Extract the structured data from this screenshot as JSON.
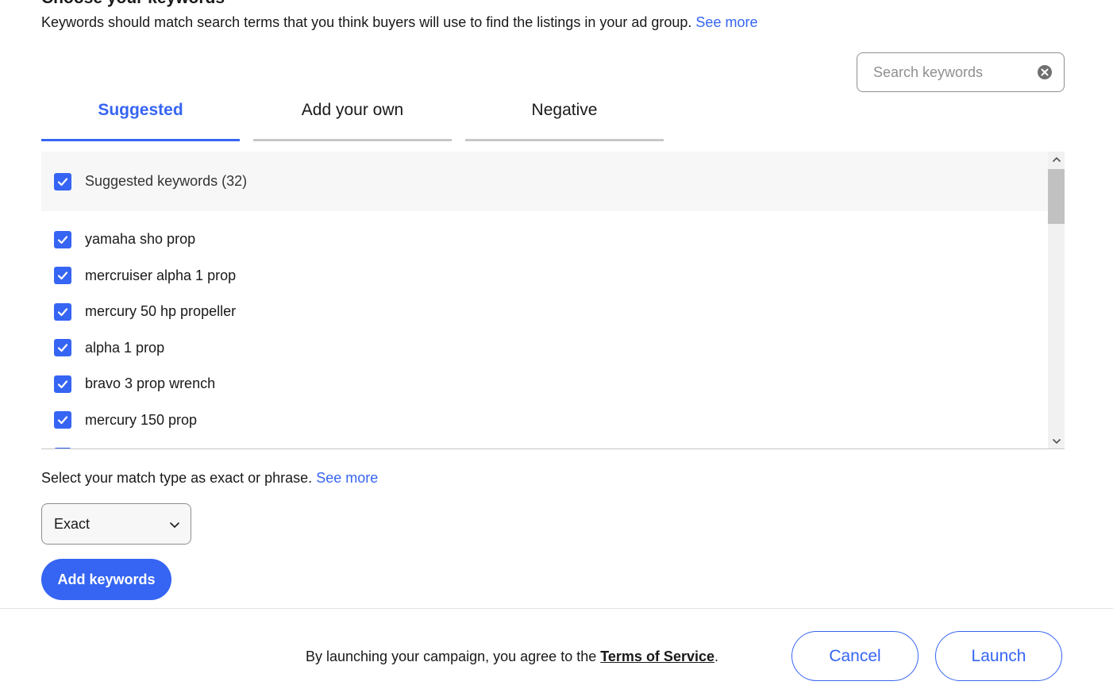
{
  "section": {
    "title": "Choose your keywords",
    "intro": "Keywords should match search terms that you think buyers will use to find the listings in your ad group.",
    "intro_link": "See more"
  },
  "search": {
    "placeholder": "Search keywords",
    "clear_icon": "clear-circle-icon"
  },
  "tabs": [
    {
      "label": "Suggested",
      "active": true
    },
    {
      "label": "Add your own",
      "active": false
    },
    {
      "label": "Negative",
      "active": false
    }
  ],
  "keywords": {
    "header_label": "Suggested keywords (32)",
    "header_checked": true,
    "items": [
      {
        "label": "yamaha sho prop",
        "checked": true
      },
      {
        "label": "mercruiser alpha 1 prop",
        "checked": true
      },
      {
        "label": "mercury 50 hp propeller",
        "checked": true
      },
      {
        "label": "alpha 1 prop",
        "checked": true
      },
      {
        "label": "bravo 3 prop wrench",
        "checked": true
      },
      {
        "label": "mercury 150 prop",
        "checked": true
      },
      {
        "label": "",
        "checked": true
      }
    ]
  },
  "match_type": {
    "text": "Select your match type as exact or phrase.",
    "link": "See more",
    "selected": "Exact"
  },
  "add_button": "Add keywords",
  "footer": {
    "terms_prefix": "By launching your campaign, you agree to the",
    "terms_link": "Terms of Service",
    "terms_suffix": ".",
    "cancel_label": "Cancel",
    "launch_label": "Launch"
  },
  "colors": {
    "accent": "#3665f3",
    "panel_bg": "#f7f7f7",
    "divider": "#c7c7c7"
  }
}
